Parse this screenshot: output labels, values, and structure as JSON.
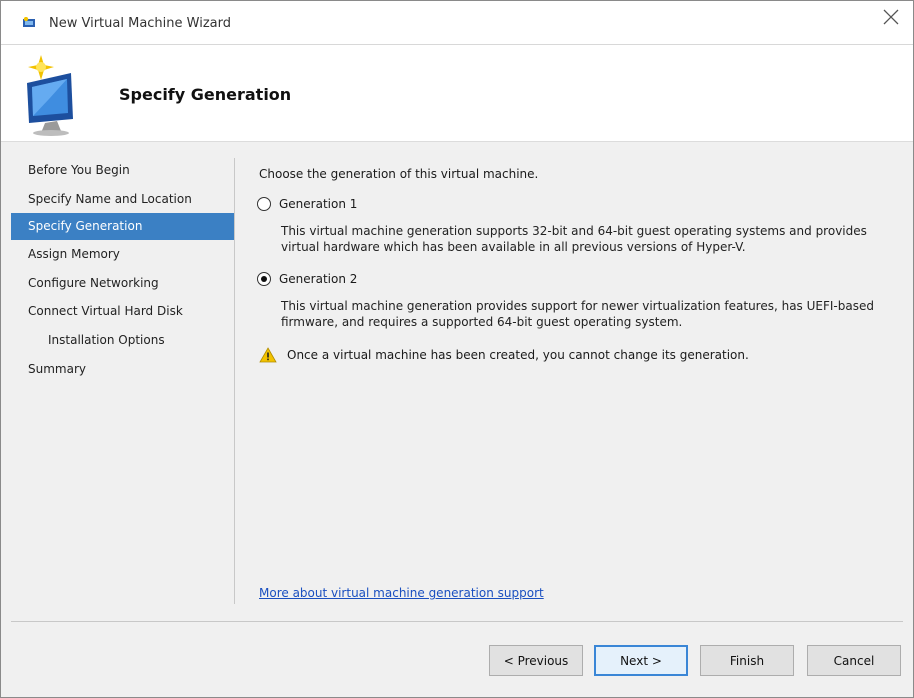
{
  "window": {
    "title": "New Virtual Machine Wizard"
  },
  "header": {
    "title": "Specify Generation"
  },
  "nav": {
    "items": [
      {
        "label": "Before You Begin",
        "active": false,
        "sub": false
      },
      {
        "label": "Specify Name and Location",
        "active": false,
        "sub": false
      },
      {
        "label": "Specify Generation",
        "active": true,
        "sub": false
      },
      {
        "label": "Assign Memory",
        "active": false,
        "sub": false
      },
      {
        "label": "Configure Networking",
        "active": false,
        "sub": false
      },
      {
        "label": "Connect Virtual Hard Disk",
        "active": false,
        "sub": false
      },
      {
        "label": "Installation Options",
        "active": false,
        "sub": true
      },
      {
        "label": "Summary",
        "active": false,
        "sub": false
      }
    ]
  },
  "content": {
    "intro": "Choose the generation of this virtual machine.",
    "gen1": {
      "label": "Generation 1",
      "checked": false,
      "desc_line1": "This virtual machine generation supports 32-bit and 64-bit guest operating systems and provides",
      "desc_line2": "virtual hardware which has been available in all previous versions of Hyper-V."
    },
    "gen2": {
      "label": "Generation 2",
      "checked": true,
      "desc_line1": "This virtual machine generation provides support for newer virtualization features, has UEFI-based",
      "desc_line2": "firmware, and requires a supported 64-bit guest operating system."
    },
    "warning": "Once a virtual machine has been created, you cannot change its generation.",
    "more_link": "More about virtual machine generation support"
  },
  "footer": {
    "previous": "< Previous",
    "next": "Next >",
    "finish": "Finish",
    "cancel": "Cancel"
  },
  "colors": {
    "nav_active": "#3b80c4",
    "link": "#1a4fc0",
    "warning": "#f2c200"
  },
  "icons": {
    "title": "hyper-v-icon",
    "header": "new-vm-wizard-icon",
    "warning": "warning-icon",
    "close": "close-icon"
  }
}
